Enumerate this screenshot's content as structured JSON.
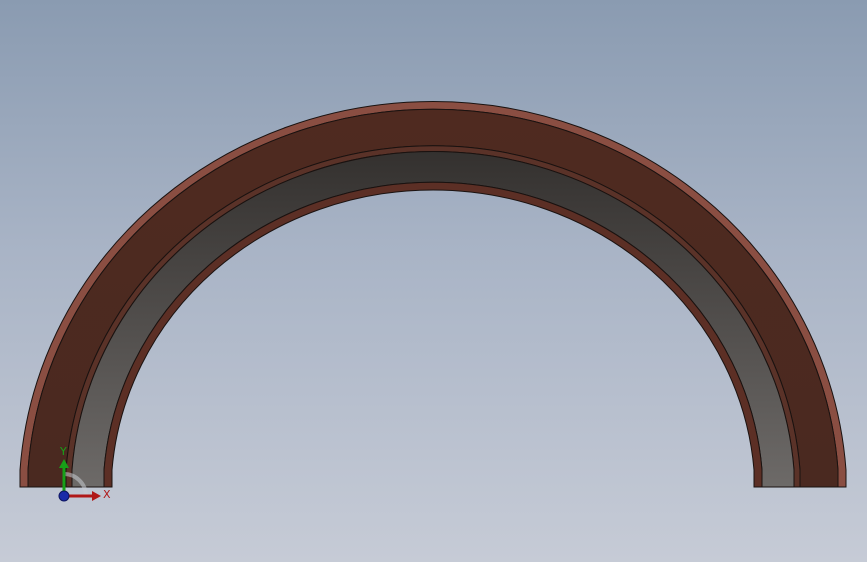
{
  "viewport": {
    "background_top": "#8a9bb1",
    "background_bottom": "#c6cbd6"
  },
  "part": {
    "outer_band_color": "#4e2b22",
    "outer_band_edge_color": "#7a4438",
    "inner_band_color": "#3e3a37",
    "inner_band_edge_color": "#6a6460",
    "outline_color": "#1a1210"
  },
  "triad": {
    "x_label": "X",
    "y_label": "Y",
    "x_color": "#b01818",
    "y_color": "#18a018",
    "z_color": "#1a2aa8"
  }
}
